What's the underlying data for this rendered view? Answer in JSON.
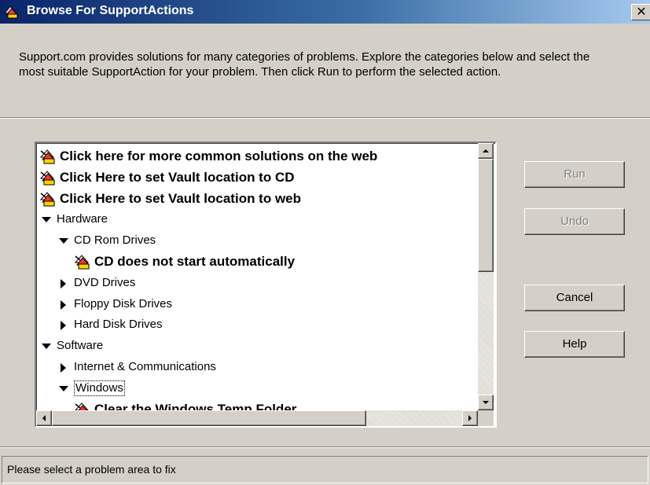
{
  "window": {
    "title": "Browse For SupportActions",
    "close_glyph": "✕"
  },
  "description": "Support.com provides solutions for many categories of problems. Explore the categories below and select the most suitable SupportAction for your problem. Then click Run to perform the selected action.",
  "tree": {
    "items": [
      {
        "label": "Click here for more common solutions on the web",
        "kind": "action",
        "depth": 0,
        "icon": "support-action-icon"
      },
      {
        "label": "Click Here to set Vault location to CD",
        "kind": "action",
        "depth": 0,
        "icon": "support-action-icon"
      },
      {
        "label": "Click Here to set Vault location to web",
        "kind": "action",
        "depth": 0,
        "icon": "support-action-icon"
      },
      {
        "label": "Hardware",
        "kind": "category",
        "depth": 0,
        "expanded": true,
        "icon": "expanded-triangle-icon"
      },
      {
        "label": "CD Rom Drives",
        "kind": "category",
        "depth": 1,
        "expanded": true,
        "icon": "expanded-triangle-icon"
      },
      {
        "label": "CD does not start automatically",
        "kind": "action",
        "depth": 2,
        "icon": "support-action-icon"
      },
      {
        "label": "DVD Drives",
        "kind": "category",
        "depth": 1,
        "expanded": false,
        "icon": "collapsed-triangle-icon"
      },
      {
        "label": "Floppy Disk Drives",
        "kind": "category",
        "depth": 1,
        "expanded": false,
        "icon": "collapsed-triangle-icon"
      },
      {
        "label": "Hard Disk Drives",
        "kind": "category",
        "depth": 1,
        "expanded": false,
        "icon": "collapsed-triangle-icon"
      },
      {
        "label": "Software",
        "kind": "category",
        "depth": 0,
        "expanded": true,
        "icon": "expanded-triangle-icon"
      },
      {
        "label": "Internet & Communications",
        "kind": "category",
        "depth": 1,
        "expanded": false,
        "icon": "collapsed-triangle-icon"
      },
      {
        "label": "Windows",
        "kind": "category",
        "depth": 1,
        "expanded": true,
        "selected": true,
        "icon": "expanded-triangle-icon"
      },
      {
        "label": "Clear the Windows Temp Folder",
        "kind": "action",
        "depth": 2,
        "icon": "support-action-icon"
      }
    ]
  },
  "buttons": {
    "run": {
      "label": "Run",
      "enabled": false
    },
    "undo": {
      "label": "Undo",
      "enabled": false
    },
    "cancel": {
      "label": "Cancel",
      "enabled": true
    },
    "help": {
      "label": "Help",
      "enabled": true
    }
  },
  "status": {
    "text": "Please select a problem area to fix"
  },
  "colors": {
    "titlebar_start": "#0a246a",
    "titlebar_end": "#a6caf0",
    "face": "#d4d0c8",
    "disabled_text": "#808080"
  }
}
